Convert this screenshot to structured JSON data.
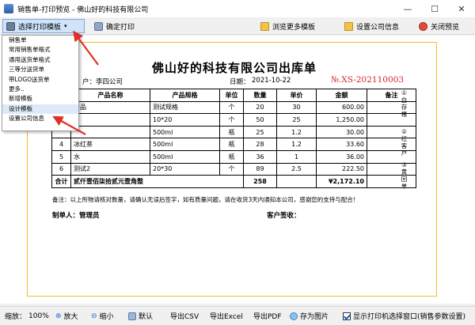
{
  "window": {
    "title": "销售单-打印预览 - 佛山好的科技有限公司",
    "minimize": "—",
    "maximize": "☐",
    "close": "✕"
  },
  "toolbar": {
    "choose_template": "选择打印模板",
    "confirm_print": "确定打印",
    "browse_templates": "浏览更多模板",
    "company_info": "设置公司信息",
    "close_preview": "关闭预览"
  },
  "dropdown": {
    "items": [
      "销售单",
      "常用销售单格式",
      "通用送货单格式",
      "三等分送货单",
      "带LOGO送货单",
      "更多..",
      "新增模板",
      "设计模板",
      "设置公司信息"
    ]
  },
  "document": {
    "title": "佛山好的科技有限公司出库单",
    "customer_label": "户：",
    "customer": "李四公司",
    "date_label": "日期：",
    "date": "2021-10-22",
    "doc_no": "№.XS-202110003",
    "columns": [
      "",
      "产品名称",
      "产品规格",
      "单位",
      "数量",
      "单价",
      "金额",
      "备注"
    ],
    "rows": [
      [
        "",
        "产品",
        "测试规格",
        "个",
        "20",
        "30",
        "600.00",
        ""
      ],
      [
        "",
        "1",
        "10*20",
        "个",
        "50",
        "25",
        "1,250.00",
        ""
      ],
      [
        "",
        "",
        "500ml",
        "瓶",
        "25",
        "1.2",
        "30.00",
        ""
      ],
      [
        "4",
        "冰红茶",
        "500ml",
        "瓶",
        "28",
        "1.2",
        "33.60",
        ""
      ],
      [
        "5",
        "水",
        "500ml",
        "瓶",
        "36",
        "1",
        "36.00",
        ""
      ],
      [
        "6",
        "测试2",
        "20*30",
        "个",
        "89",
        "2.5",
        "222.50",
        ""
      ]
    ],
    "total_label": "合计",
    "total_words": "贰仟壹佰柒拾贰元壹角整",
    "total_qty": "258",
    "total_amount": "¥2,172.10",
    "side_notes": [
      "①白存根",
      "②红客户",
      "③黄回单"
    ],
    "note": "备注：以上所物请核对数量，请确认无误后签字，如有质量问题，请在收货3天内通知本公司，感谢您的支持与配合！",
    "maker_label": "制单人：管理员",
    "sign_label": "客户签收："
  },
  "statusbar": {
    "zoom_label": "缩放：",
    "zoom_value": "100%",
    "zoom_in": "放大",
    "zoom_out": "缩小",
    "default": "默认",
    "export_csv": "导出CSV",
    "export_excel": "导出Excel",
    "export_pdf": "导出PDF",
    "save_image": "存为图片",
    "show_printer": "显示打印机选择窗口(销售参数设置)"
  }
}
